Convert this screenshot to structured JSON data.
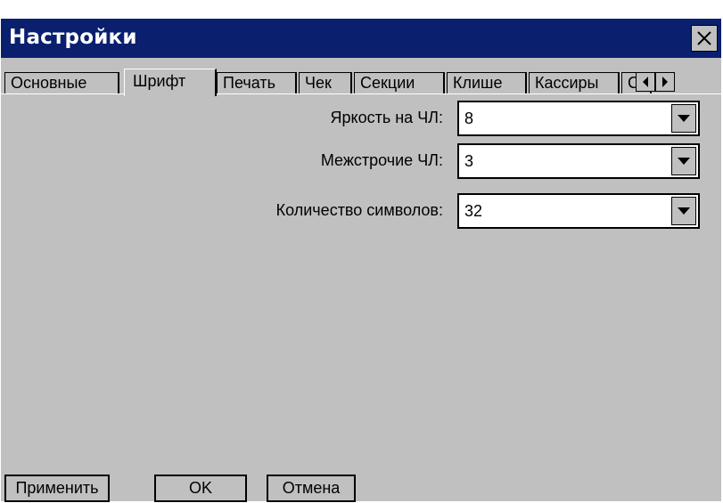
{
  "window": {
    "title": "Настройки",
    "close_icon": "close-icon"
  },
  "tabs": [
    {
      "label": "Основные",
      "active": false
    },
    {
      "label": "Шрифт",
      "active": true
    },
    {
      "label": "Печать",
      "active": false
    },
    {
      "label": "Чек",
      "active": false
    },
    {
      "label": "Секции",
      "active": false
    },
    {
      "label": "Клише",
      "active": false
    },
    {
      "label": "Кассиры",
      "active": false
    },
    {
      "label": "С",
      "active": false
    }
  ],
  "tab_scroll": {
    "left_icon": "arrow-left-icon",
    "right_icon": "arrow-right-icon"
  },
  "fields": [
    {
      "label": "Яркость на ЧЛ:",
      "value": "8"
    },
    {
      "label": "Межстрочие ЧЛ:",
      "value": "3"
    },
    {
      "label": "Количество символов:",
      "value": "32"
    }
  ],
  "buttons": {
    "apply": "Применить",
    "ok": "OK",
    "cancel": "Отмена"
  }
}
